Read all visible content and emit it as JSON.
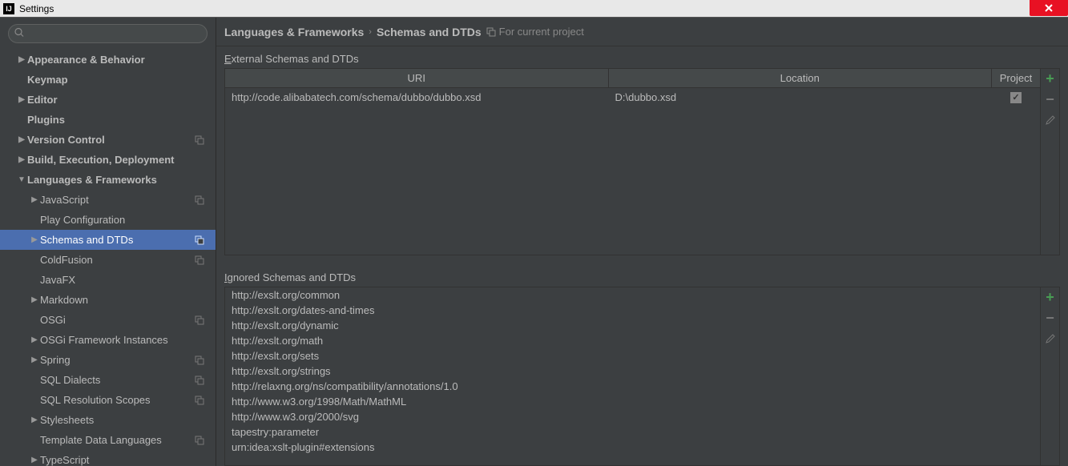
{
  "window": {
    "title": "Settings"
  },
  "search": {
    "placeholder": ""
  },
  "sidebar": {
    "items": [
      {
        "label": "Appearance & Behavior",
        "arrow": "right",
        "bold": true,
        "indent": 0,
        "copy": false
      },
      {
        "label": "Keymap",
        "arrow": "none",
        "bold": true,
        "indent": 0,
        "copy": false
      },
      {
        "label": "Editor",
        "arrow": "right",
        "bold": true,
        "indent": 0,
        "copy": false
      },
      {
        "label": "Plugins",
        "arrow": "none",
        "bold": true,
        "indent": 0,
        "copy": false
      },
      {
        "label": "Version Control",
        "arrow": "right",
        "bold": true,
        "indent": 0,
        "copy": true
      },
      {
        "label": "Build, Execution, Deployment",
        "arrow": "right",
        "bold": true,
        "indent": 0,
        "copy": false
      },
      {
        "label": "Languages & Frameworks",
        "arrow": "down",
        "bold": true,
        "indent": 0,
        "copy": false
      },
      {
        "label": "JavaScript",
        "arrow": "right",
        "bold": false,
        "indent": 1,
        "copy": true
      },
      {
        "label": "Play Configuration",
        "arrow": "none",
        "bold": false,
        "indent": 1,
        "copy": false
      },
      {
        "label": "Schemas and DTDs",
        "arrow": "right",
        "bold": false,
        "indent": 1,
        "copy": true,
        "selected": true
      },
      {
        "label": "ColdFusion",
        "arrow": "none",
        "bold": false,
        "indent": 1,
        "copy": true
      },
      {
        "label": "JavaFX",
        "arrow": "none",
        "bold": false,
        "indent": 1,
        "copy": false
      },
      {
        "label": "Markdown",
        "arrow": "right",
        "bold": false,
        "indent": 1,
        "copy": false
      },
      {
        "label": "OSGi",
        "arrow": "none",
        "bold": false,
        "indent": 1,
        "copy": true
      },
      {
        "label": "OSGi Framework Instances",
        "arrow": "right",
        "bold": false,
        "indent": 1,
        "copy": false
      },
      {
        "label": "Spring",
        "arrow": "right",
        "bold": false,
        "indent": 1,
        "copy": true
      },
      {
        "label": "SQL Dialects",
        "arrow": "none",
        "bold": false,
        "indent": 1,
        "copy": true
      },
      {
        "label": "SQL Resolution Scopes",
        "arrow": "none",
        "bold": false,
        "indent": 1,
        "copy": true
      },
      {
        "label": "Stylesheets",
        "arrow": "right",
        "bold": false,
        "indent": 1,
        "copy": false
      },
      {
        "label": "Template Data Languages",
        "arrow": "none",
        "bold": false,
        "indent": 1,
        "copy": true
      },
      {
        "label": "TypeScript",
        "arrow": "right",
        "bold": false,
        "indent": 1,
        "copy": false
      }
    ]
  },
  "breadcrumb": {
    "parent": "Languages & Frameworks",
    "current": "Schemas and DTDs",
    "scope": "For current project"
  },
  "external": {
    "section_label_pre": "E",
    "section_label_rest": "xternal Schemas and DTDs",
    "headers": {
      "uri": "URI",
      "location": "Location",
      "project": "Project"
    },
    "rows": [
      {
        "uri": "http://code.alibabatech.com/schema/dubbo/dubbo.xsd",
        "location": "D:\\dubbo.xsd",
        "project": true
      }
    ]
  },
  "ignored": {
    "section_label_pre": "I",
    "section_label_rest": "gnored Schemas and DTDs",
    "items": [
      "http://exslt.org/common",
      "http://exslt.org/dates-and-times",
      "http://exslt.org/dynamic",
      "http://exslt.org/math",
      "http://exslt.org/sets",
      "http://exslt.org/strings",
      "http://relaxng.org/ns/compatibility/annotations/1.0",
      "http://www.w3.org/1998/Math/MathML",
      "http://www.w3.org/2000/svg",
      "tapestry:parameter",
      "urn:idea:xslt-plugin#extensions"
    ]
  }
}
